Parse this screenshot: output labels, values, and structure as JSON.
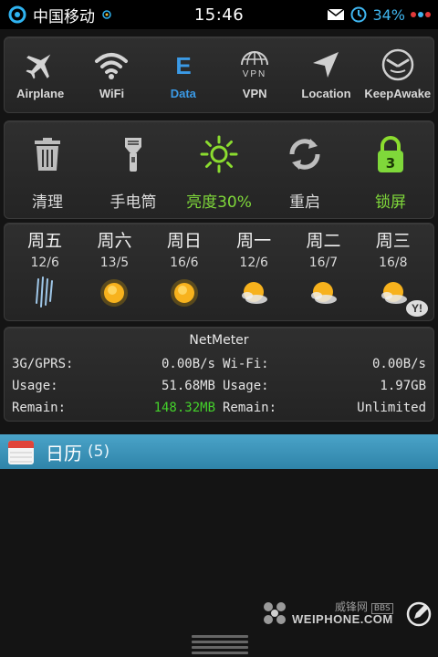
{
  "status_bar": {
    "carrier": "中国移动",
    "time": "15:46",
    "battery": "34%",
    "icons": [
      "signal-ring-icon",
      "sync-icon",
      "mail-icon",
      "alarm-icon",
      "dots-icon"
    ]
  },
  "toggles": [
    {
      "label": "Airplane",
      "icon": "airplane-icon",
      "active": false
    },
    {
      "label": "WiFi",
      "icon": "wifi-icon",
      "active": false
    },
    {
      "label": "Data",
      "icon": "data-icon",
      "glyph": "E",
      "active": true
    },
    {
      "label": "VPN",
      "icon": "vpn-icon",
      "glyph": "VPN",
      "active": false
    },
    {
      "label": "Location",
      "icon": "location-icon",
      "active": false
    },
    {
      "label": "KeepAwake",
      "icon": "keepawake-icon",
      "active": false
    }
  ],
  "tools": [
    {
      "label": "清理",
      "icon": "trash-icon"
    },
    {
      "label": "手电筒",
      "icon": "flashlight-icon"
    },
    {
      "label": "亮度30%",
      "icon": "brightness-icon"
    },
    {
      "label": "重启",
      "icon": "restart-icon"
    },
    {
      "label": "锁屏",
      "icon": "lock-icon",
      "badge": "3"
    }
  ],
  "weather": {
    "days": [
      {
        "name": "周五",
        "temp": "12/6",
        "icon": "rain-icon"
      },
      {
        "name": "周六",
        "temp": "13/5",
        "icon": "sun-icon"
      },
      {
        "name": "周日",
        "temp": "16/6",
        "icon": "sun-icon"
      },
      {
        "name": "周一",
        "temp": "12/6",
        "icon": "partly-cloudy-icon"
      },
      {
        "name": "周二",
        "temp": "16/7",
        "icon": "partly-cloudy-icon"
      },
      {
        "name": "周三",
        "temp": "16/8",
        "icon": "partly-cloudy-icon"
      }
    ],
    "provider": "Y!"
  },
  "netmeter": {
    "title": "NetMeter",
    "left": [
      {
        "label": "3G/GPRS:",
        "value": "0.00B/s"
      },
      {
        "label": "Usage:",
        "value": "51.68MB"
      },
      {
        "label": "Remain:",
        "value": "148.32MB",
        "highlight": true
      }
    ],
    "right": [
      {
        "label": "Wi-Fi:",
        "value": "0.00B/s"
      },
      {
        "label": "Usage:",
        "value": "1.97GB"
      },
      {
        "label": "Remain:",
        "value": "Unlimited"
      }
    ]
  },
  "calendar": {
    "title": "日历",
    "count": "(5)"
  },
  "watermark": {
    "cn": "威锋网",
    "badge": "BBS",
    "en": "WEIPHONE.COM"
  },
  "colors": {
    "accent_blue": "#3b9ae6",
    "battery_blue": "#3fb6f0",
    "green_label": "#7fd83a",
    "green_value": "#44d12b",
    "calendar_bar": "#3a94bb"
  }
}
